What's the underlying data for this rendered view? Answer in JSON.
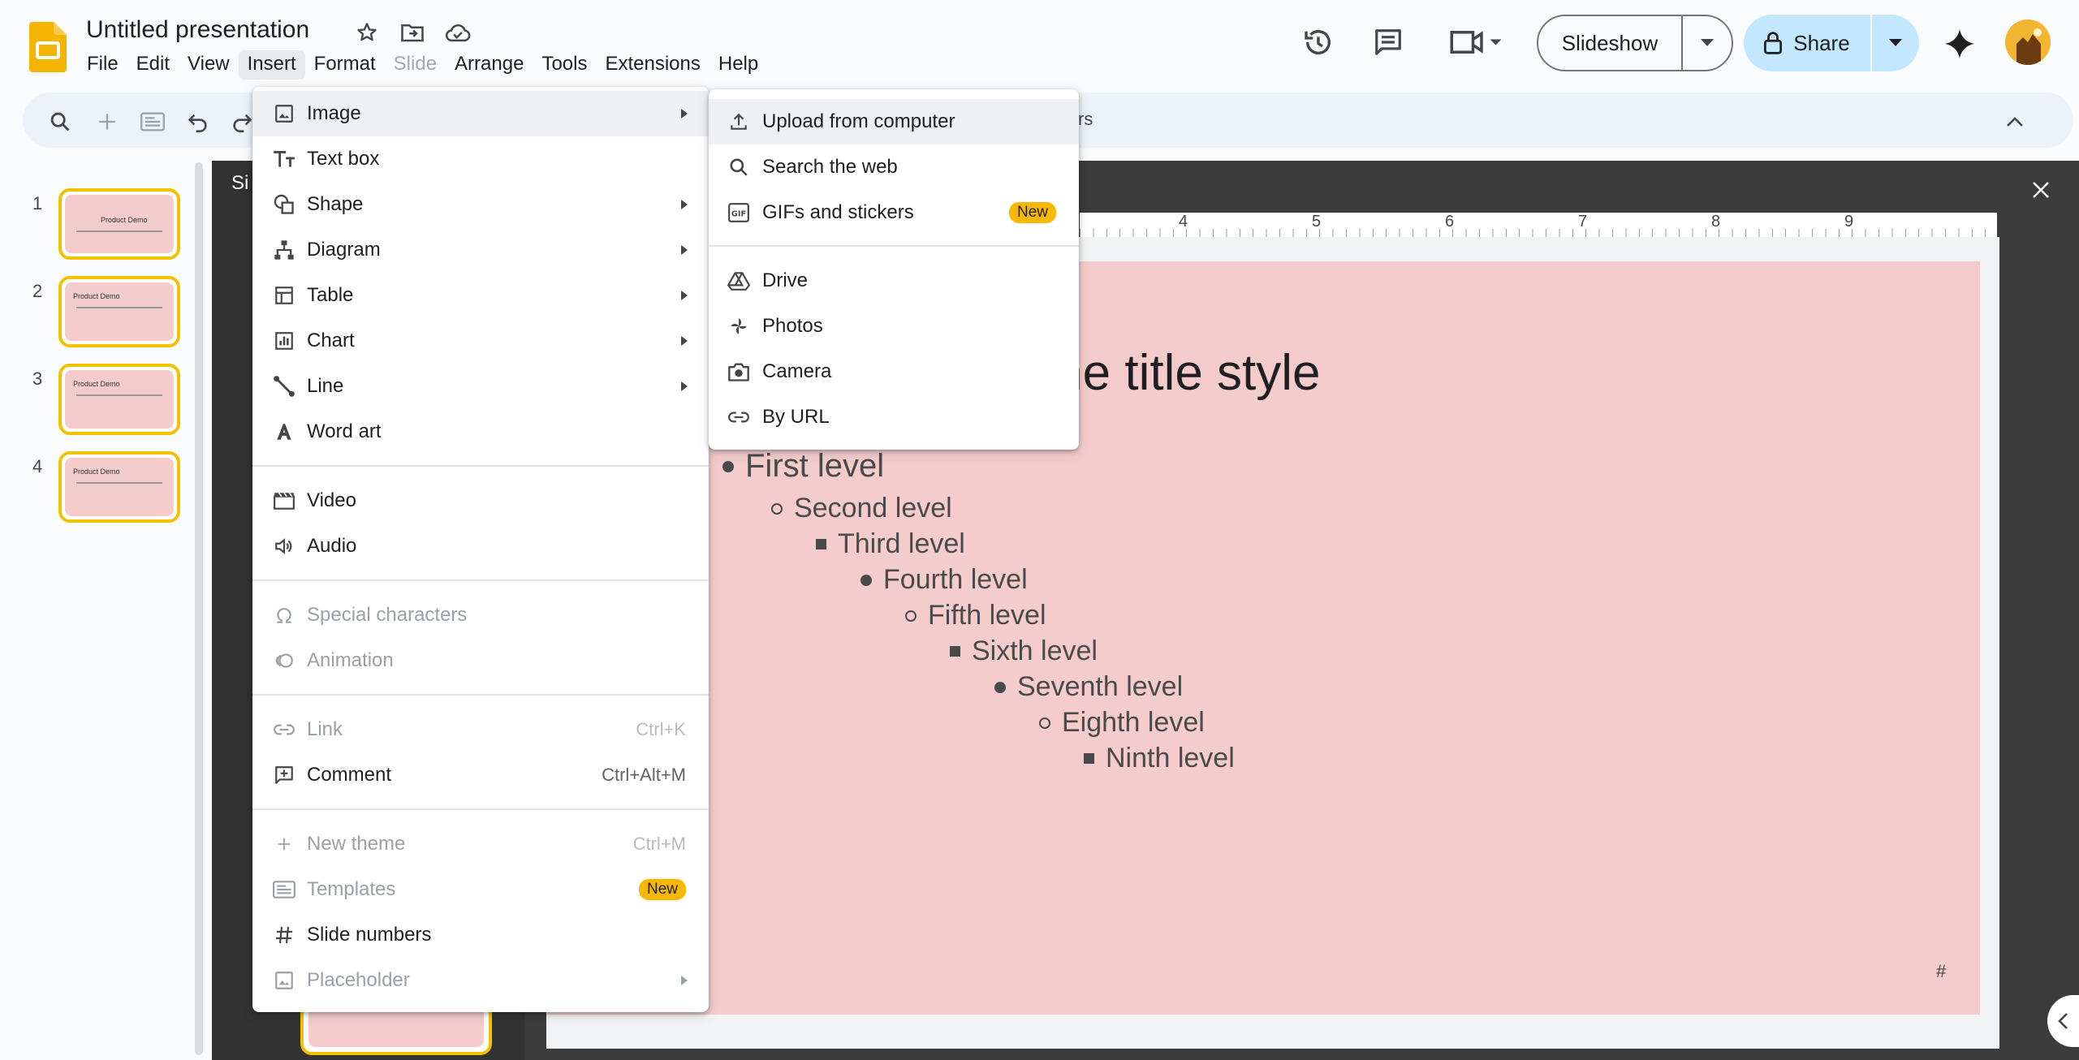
{
  "doc": {
    "title": "Untitled presentation"
  },
  "menubar": [
    "File",
    "Edit",
    "View",
    "Insert",
    "Format",
    "Slide",
    "Arrange",
    "Tools",
    "Extensions",
    "Help"
  ],
  "header": {
    "slideshow_label": "Slideshow",
    "share_label": "Share"
  },
  "toolbar": {
    "hint_fragment": "rs"
  },
  "filmstrip": {
    "slides": [
      {
        "num": "1",
        "title": "Product Demo"
      },
      {
        "num": "2",
        "title": "Product Demo"
      },
      {
        "num": "3",
        "title": "Product Demo"
      },
      {
        "num": "4",
        "title": "Product Demo"
      }
    ]
  },
  "editor": {
    "panel_title_fragment": "Si",
    "ruler": [
      "4",
      "5",
      "6",
      "7",
      "8",
      "9"
    ],
    "slide_title": "me title style",
    "bullets": [
      "First level",
      "Second level",
      "Third level",
      "Fourth level",
      "Fifth level",
      "Sixth level",
      "Seventh level",
      "Eighth level",
      "Ninth level"
    ],
    "slide_number_placeholder": "#"
  },
  "insert_menu": {
    "image": "Image",
    "text_box": "Text box",
    "shape": "Shape",
    "diagram": "Diagram",
    "table": "Table",
    "chart": "Chart",
    "line": "Line",
    "word_art": "Word art",
    "video": "Video",
    "audio": "Audio",
    "special_characters": "Special characters",
    "animation": "Animation",
    "link": "Link",
    "link_shortcut": "Ctrl+K",
    "comment": "Comment",
    "comment_shortcut": "Ctrl+Alt+M",
    "new_theme": "New theme",
    "new_theme_shortcut": "Ctrl+M",
    "templates": "Templates",
    "templates_badge": "New",
    "slide_numbers": "Slide numbers",
    "placeholder": "Placeholder"
  },
  "image_menu": {
    "upload": "Upload from computer",
    "search_web": "Search the web",
    "gifs": "GIFs and stickers",
    "gifs_badge": "New",
    "drive": "Drive",
    "photos": "Photos",
    "camera": "Camera",
    "by_url": "By URL"
  },
  "colors": {
    "accent_yellow": "#f2c200",
    "slide_bg": "#f4cccc",
    "share_bg": "#c2e7ff",
    "badge": "#f9b800"
  }
}
